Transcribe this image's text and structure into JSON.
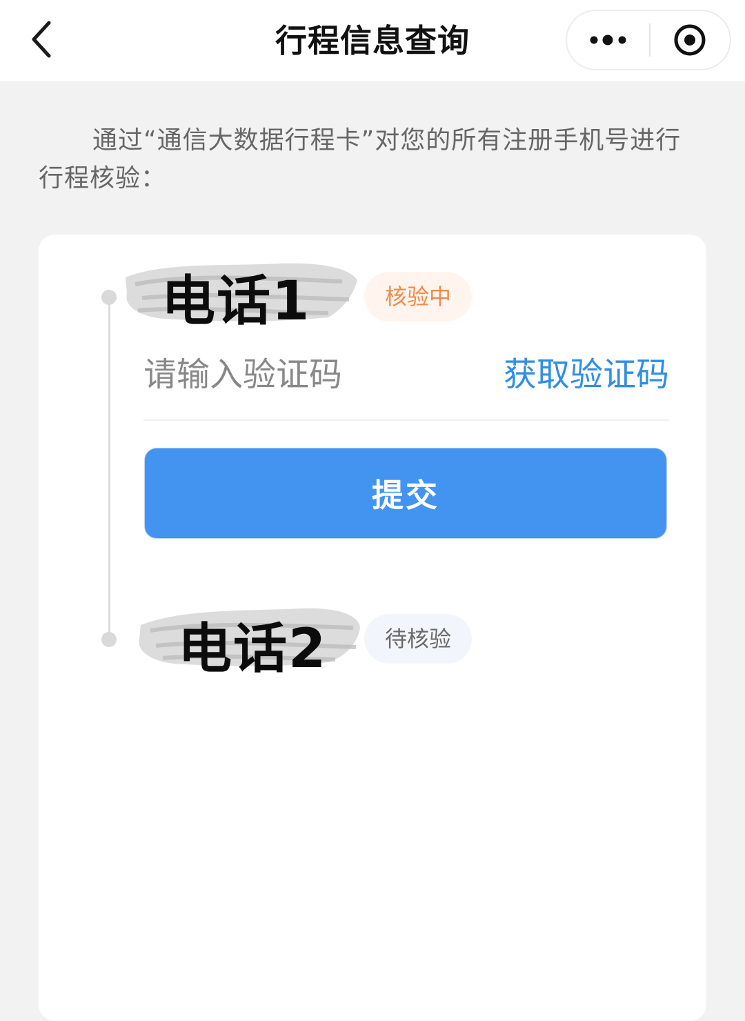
{
  "nav": {
    "title": "行程信息查询",
    "back_icon": "chevron-left-icon",
    "more_icon": "more-dots-icon",
    "close_icon": "target-close-icon"
  },
  "intro": {
    "text": "通过“通信大数据行程卡”对您的所有注册手机号进行行程核验："
  },
  "phones": [
    {
      "label": "电话1",
      "status": "核验中",
      "code_placeholder": "请输入验证码",
      "get_code_label": "获取验证码",
      "submit_label": "提交"
    },
    {
      "label": "电话2",
      "status": "待核验"
    }
  ],
  "colors": {
    "accent": "#4394f0",
    "link": "#2f8ee6",
    "badge_active_text": "#f08a4b",
    "badge_active_bg": "#fff5ee",
    "badge_pending_bg": "#f2f6fc",
    "page_bg": "#f2f2f2"
  }
}
